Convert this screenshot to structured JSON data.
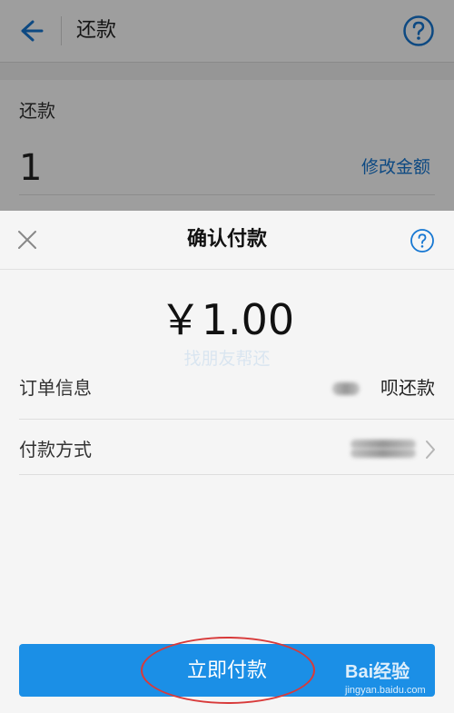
{
  "background_page": {
    "title": "还款",
    "repay_label": "还款",
    "amount": "1",
    "edit_amount_link": "修改金额",
    "faded_button_text": "找朋友帮还"
  },
  "payment_sheet": {
    "title": "确认付款",
    "amount": "￥1.00",
    "rows": [
      {
        "label": "订单信息",
        "value": "呗还款"
      },
      {
        "label": "付款方式",
        "value": ""
      }
    ],
    "pay_button_label": "立即付款"
  },
  "watermark": {
    "brand": "Bai经验",
    "url": "jingyan.baidu.com"
  },
  "colors": {
    "accent": "#1677d2",
    "pay_button": "#1b8fe6",
    "highlight_circle": "#d83a3a"
  }
}
